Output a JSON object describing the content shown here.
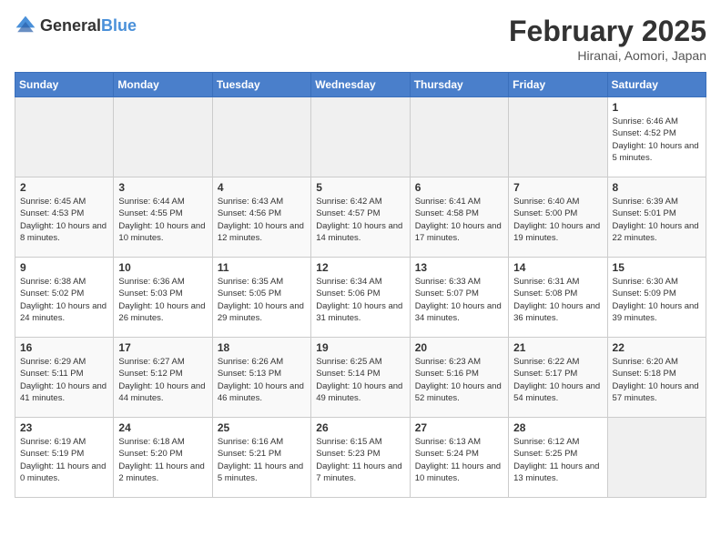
{
  "header": {
    "logo_general": "General",
    "logo_blue": "Blue",
    "month_year": "February 2025",
    "location": "Hiranai, Aomori, Japan"
  },
  "weekdays": [
    "Sunday",
    "Monday",
    "Tuesday",
    "Wednesday",
    "Thursday",
    "Friday",
    "Saturday"
  ],
  "weeks": [
    [
      {
        "day": "",
        "info": ""
      },
      {
        "day": "",
        "info": ""
      },
      {
        "day": "",
        "info": ""
      },
      {
        "day": "",
        "info": ""
      },
      {
        "day": "",
        "info": ""
      },
      {
        "day": "",
        "info": ""
      },
      {
        "day": "1",
        "info": "Sunrise: 6:46 AM\nSunset: 4:52 PM\nDaylight: 10 hours and 5 minutes."
      }
    ],
    [
      {
        "day": "2",
        "info": "Sunrise: 6:45 AM\nSunset: 4:53 PM\nDaylight: 10 hours and 8 minutes."
      },
      {
        "day": "3",
        "info": "Sunrise: 6:44 AM\nSunset: 4:55 PM\nDaylight: 10 hours and 10 minutes."
      },
      {
        "day": "4",
        "info": "Sunrise: 6:43 AM\nSunset: 4:56 PM\nDaylight: 10 hours and 12 minutes."
      },
      {
        "day": "5",
        "info": "Sunrise: 6:42 AM\nSunset: 4:57 PM\nDaylight: 10 hours and 14 minutes."
      },
      {
        "day": "6",
        "info": "Sunrise: 6:41 AM\nSunset: 4:58 PM\nDaylight: 10 hours and 17 minutes."
      },
      {
        "day": "7",
        "info": "Sunrise: 6:40 AM\nSunset: 5:00 PM\nDaylight: 10 hours and 19 minutes."
      },
      {
        "day": "8",
        "info": "Sunrise: 6:39 AM\nSunset: 5:01 PM\nDaylight: 10 hours and 22 minutes."
      }
    ],
    [
      {
        "day": "9",
        "info": "Sunrise: 6:38 AM\nSunset: 5:02 PM\nDaylight: 10 hours and 24 minutes."
      },
      {
        "day": "10",
        "info": "Sunrise: 6:36 AM\nSunset: 5:03 PM\nDaylight: 10 hours and 26 minutes."
      },
      {
        "day": "11",
        "info": "Sunrise: 6:35 AM\nSunset: 5:05 PM\nDaylight: 10 hours and 29 minutes."
      },
      {
        "day": "12",
        "info": "Sunrise: 6:34 AM\nSunset: 5:06 PM\nDaylight: 10 hours and 31 minutes."
      },
      {
        "day": "13",
        "info": "Sunrise: 6:33 AM\nSunset: 5:07 PM\nDaylight: 10 hours and 34 minutes."
      },
      {
        "day": "14",
        "info": "Sunrise: 6:31 AM\nSunset: 5:08 PM\nDaylight: 10 hours and 36 minutes."
      },
      {
        "day": "15",
        "info": "Sunrise: 6:30 AM\nSunset: 5:09 PM\nDaylight: 10 hours and 39 minutes."
      }
    ],
    [
      {
        "day": "16",
        "info": "Sunrise: 6:29 AM\nSunset: 5:11 PM\nDaylight: 10 hours and 41 minutes."
      },
      {
        "day": "17",
        "info": "Sunrise: 6:27 AM\nSunset: 5:12 PM\nDaylight: 10 hours and 44 minutes."
      },
      {
        "day": "18",
        "info": "Sunrise: 6:26 AM\nSunset: 5:13 PM\nDaylight: 10 hours and 46 minutes."
      },
      {
        "day": "19",
        "info": "Sunrise: 6:25 AM\nSunset: 5:14 PM\nDaylight: 10 hours and 49 minutes."
      },
      {
        "day": "20",
        "info": "Sunrise: 6:23 AM\nSunset: 5:16 PM\nDaylight: 10 hours and 52 minutes."
      },
      {
        "day": "21",
        "info": "Sunrise: 6:22 AM\nSunset: 5:17 PM\nDaylight: 10 hours and 54 minutes."
      },
      {
        "day": "22",
        "info": "Sunrise: 6:20 AM\nSunset: 5:18 PM\nDaylight: 10 hours and 57 minutes."
      }
    ],
    [
      {
        "day": "23",
        "info": "Sunrise: 6:19 AM\nSunset: 5:19 PM\nDaylight: 11 hours and 0 minutes."
      },
      {
        "day": "24",
        "info": "Sunrise: 6:18 AM\nSunset: 5:20 PM\nDaylight: 11 hours and 2 minutes."
      },
      {
        "day": "25",
        "info": "Sunrise: 6:16 AM\nSunset: 5:21 PM\nDaylight: 11 hours and 5 minutes."
      },
      {
        "day": "26",
        "info": "Sunrise: 6:15 AM\nSunset: 5:23 PM\nDaylight: 11 hours and 7 minutes."
      },
      {
        "day": "27",
        "info": "Sunrise: 6:13 AM\nSunset: 5:24 PM\nDaylight: 11 hours and 10 minutes."
      },
      {
        "day": "28",
        "info": "Sunrise: 6:12 AM\nSunset: 5:25 PM\nDaylight: 11 hours and 13 minutes."
      },
      {
        "day": "",
        "info": ""
      }
    ]
  ]
}
